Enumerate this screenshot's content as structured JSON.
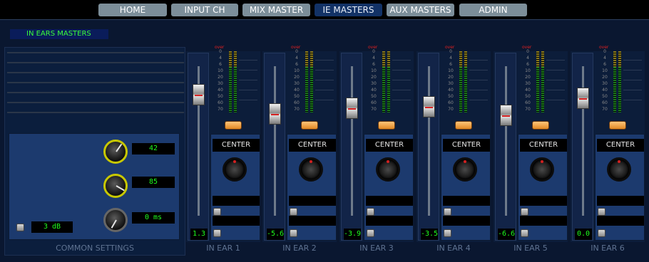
{
  "nav": {
    "tabs": [
      {
        "label": "HOME",
        "active": false
      },
      {
        "label": "INPUT CH",
        "active": false
      },
      {
        "label": "MIX MASTER",
        "active": false
      },
      {
        "label": "IE MASTERS",
        "active": true
      },
      {
        "label": "AUX MASTERS",
        "active": false
      },
      {
        "label": "ADMIN",
        "active": false
      }
    ]
  },
  "page_title": "IN EARS MASTERS",
  "common": {
    "label": "COMMON SETTINGS",
    "knob1_value": "42",
    "knob2_value": "85",
    "knob3_value": "0 ms",
    "gain_value": "3 dB"
  },
  "meter": {
    "over_label": "over",
    "scale": [
      "0",
      "4",
      "6",
      "10",
      "20",
      "30",
      "40",
      "50",
      "60",
      "70"
    ]
  },
  "pan_label": "CENTER",
  "channels": [
    {
      "name": "IN EAR 1",
      "fader": "1.3"
    },
    {
      "name": "IN EAR 2",
      "fader": "-5.6"
    },
    {
      "name": "IN EAR 3",
      "fader": "-3.9"
    },
    {
      "name": "IN EAR 4",
      "fader": "-3.5"
    },
    {
      "name": "IN EAR 5",
      "fader": "-6.6"
    },
    {
      "name": "IN EAR 6",
      "fader": "0.0"
    }
  ],
  "colors": {
    "accent_green": "#1eff1e",
    "tab_active": "#123266",
    "tab_idle": "#7c8e99",
    "knob_ring": "#c8c800",
    "button_orange": "#f0a040"
  }
}
